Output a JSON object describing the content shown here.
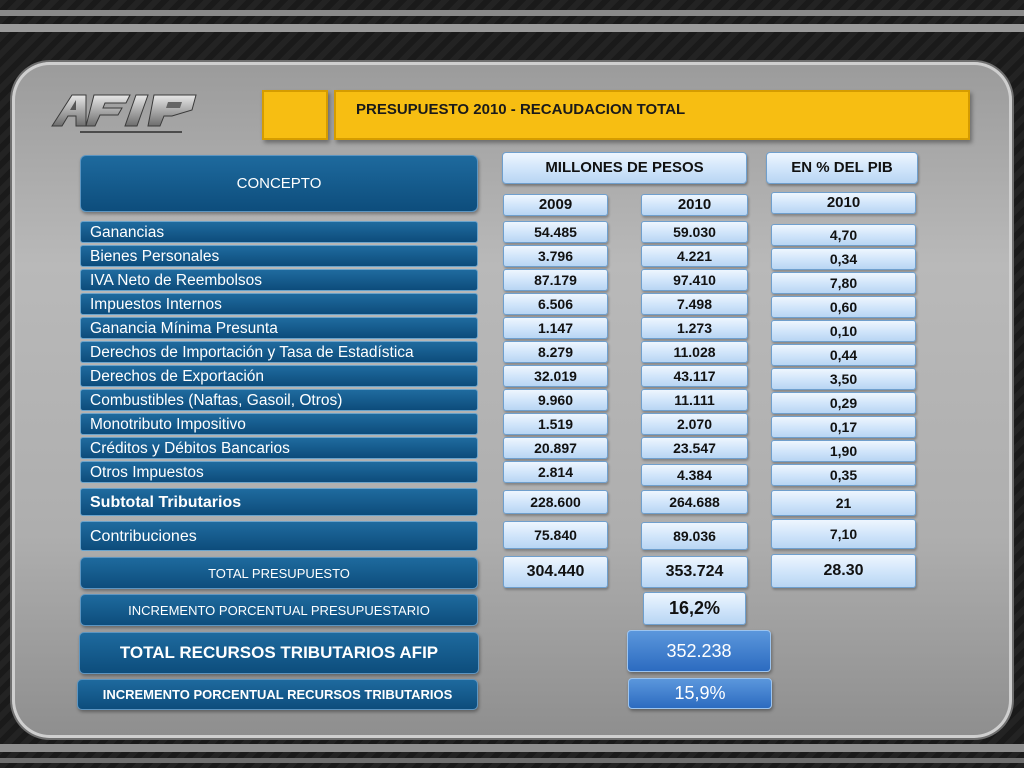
{
  "title": "PRESUPUESTO 2010  - RECAUDACION TOTAL",
  "logo_text": "AFIP",
  "headers": {
    "concepto": "CONCEPTO",
    "millones": "MILLONES DE PESOS",
    "pib": "EN % DEL  PIB",
    "col_2009": "2009",
    "col_2010": "2010",
    "col_pib_2010": "2010"
  },
  "rows": [
    {
      "concepto": "Ganancias",
      "y2009": "54.485",
      "y2010": "59.030",
      "pib": "4,70"
    },
    {
      "concepto": "Bienes Personales",
      "y2009": "3.796",
      "y2010": "4.221",
      "pib": "0,34"
    },
    {
      "concepto": "IVA Neto de Reembolsos",
      "y2009": "87.179",
      "y2010": "97.410",
      "pib": "7,80"
    },
    {
      "concepto": "Impuestos Internos",
      "y2009": "6.506",
      "y2010": "7.498",
      "pib": "0,60"
    },
    {
      "concepto": "Ganancia Mínima Presunta",
      "y2009": "1.147",
      "y2010": "1.273",
      "pib": "0,10"
    },
    {
      "concepto": "Derechos de Importación y Tasa de Estadística",
      "y2009": "8.279",
      "y2010": "11.028",
      "pib": "0,44"
    },
    {
      "concepto": "Derechos de Exportación",
      "y2009": "32.019",
      "y2010": "43.117",
      "pib": "3,50"
    },
    {
      "concepto": "Combustibles (Naftas, Gasoil, Otros)",
      "y2009": "9.960",
      "y2010": "11.111",
      "pib": "0,29"
    },
    {
      "concepto": "Monotributo Impositivo",
      "y2009": "1.519",
      "y2010": "2.070",
      "pib": "0,17"
    },
    {
      "concepto": "Créditos y Débitos Bancarios",
      "y2009": "20.897",
      "y2010": "23.547",
      "pib": "1,90"
    },
    {
      "concepto": "Otros Impuestos",
      "y2009": "2.814",
      "y2010": "4.384",
      "pib": "0,35"
    }
  ],
  "subtotal": {
    "concepto": "Subtotal Tributarios",
    "y2009": "228.600",
    "y2010": "264.688",
    "pib": "21"
  },
  "contribuciones": {
    "concepto": "Contribuciones",
    "y2009": "75.840",
    "y2010": "89.036",
    "pib": "7,10"
  },
  "total_presupuesto": {
    "label": "TOTAL PRESUPUESTO",
    "y2009": "304.440",
    "y2010": "353.724",
    "pib": "28.30"
  },
  "incremento_presupuestario": {
    "label": "INCREMENTO  PORCENTUAL PRESUPUESTARIO",
    "value": "16,2%"
  },
  "total_recursos": {
    "label": "TOTAL  RECURSOS TRIBUTARIOS AFIP",
    "value": "352.238"
  },
  "incremento_recursos": {
    "label": "INCREMENTO PORCENTUAL RECURSOS TRIBUTARIOS",
    "value": "15,9%"
  },
  "colors": {
    "accent_yellow": "#f7be12",
    "dark_blue": "#0d4d7c",
    "light_blue": "#cfe4fa",
    "solid_blue": "#2c6bc0"
  }
}
